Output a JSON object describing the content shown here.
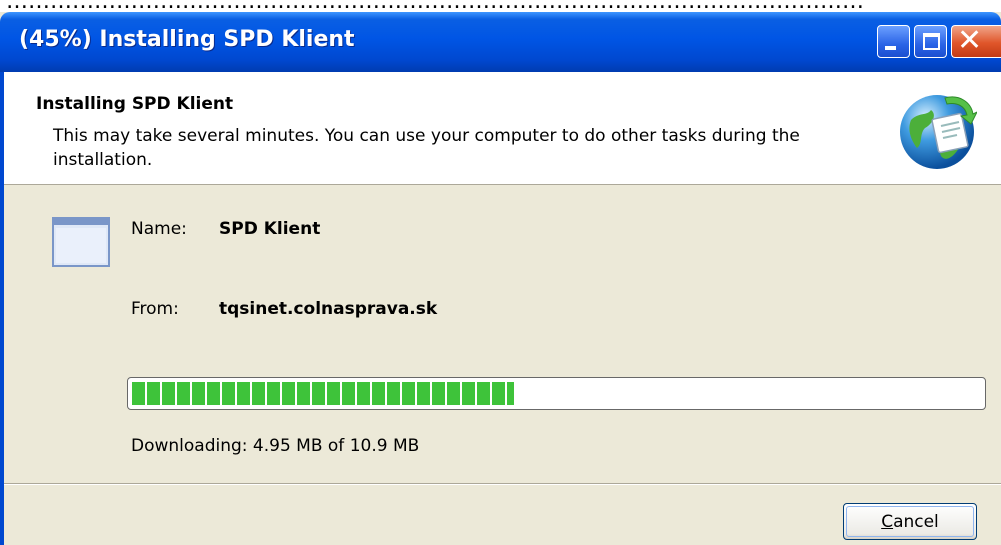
{
  "window": {
    "title": "(45%) Installing SPD Klient",
    "controls": {
      "minimize_icon": "minimize-icon",
      "maximize_icon": "maximize-icon",
      "close_icon": "close-icon"
    }
  },
  "header": {
    "title": "Installing SPD Klient",
    "subtitle": "This may take several minutes. You can use your computer to do other tasks during the installation.",
    "icon": "globe-install-icon"
  },
  "details": {
    "name_label": "Name:",
    "name_value": "SPD Klient",
    "from_label": "From:",
    "from_value": "tqsinet.colnasprava.sk",
    "app_icon": "application-window-icon"
  },
  "progress": {
    "percent": 45,
    "status": "Downloading: 4.95 MB of 10.9 MB",
    "color": "#3ec33a"
  },
  "footer": {
    "cancel_mnemonic": "C",
    "cancel_rest": "ancel"
  },
  "colors": {
    "titlebar": "#0055e5",
    "dialog_background": "#ece9d8",
    "close_button": "#e0562a"
  }
}
